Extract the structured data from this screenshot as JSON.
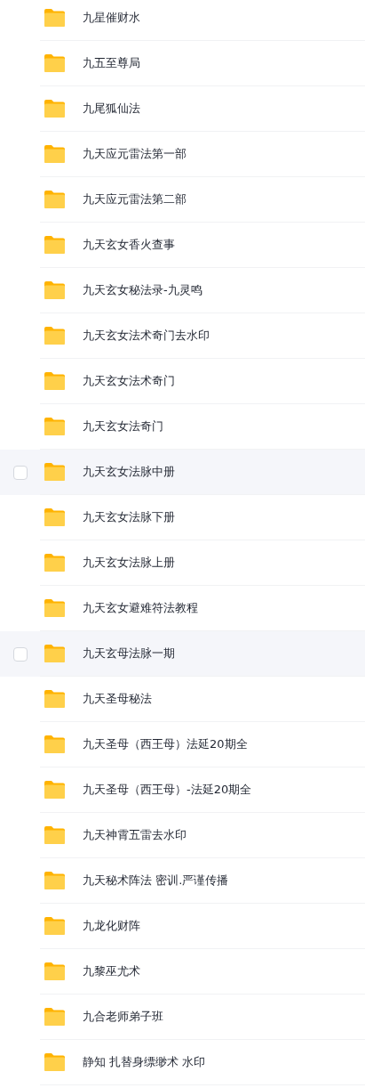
{
  "folders": [
    {
      "name": "九星催财水",
      "hovered": false
    },
    {
      "name": "九五至尊局",
      "hovered": false
    },
    {
      "name": "九尾狐仙法",
      "hovered": false
    },
    {
      "name": "九天应元雷法第一部",
      "hovered": false
    },
    {
      "name": "九天应元雷法第二部",
      "hovered": false
    },
    {
      "name": "九天玄女香火查事",
      "hovered": false
    },
    {
      "name": "九天玄女秘法录-九灵鸣",
      "hovered": false
    },
    {
      "name": "九天玄女法术奇门去水印",
      "hovered": false
    },
    {
      "name": "九天玄女法术奇门",
      "hovered": false
    },
    {
      "name": "九天玄女法奇门",
      "hovered": false
    },
    {
      "name": "九天玄女法脉中册",
      "hovered": true
    },
    {
      "name": "九天玄女法脉下册",
      "hovered": false
    },
    {
      "name": "九天玄女法脉上册",
      "hovered": false
    },
    {
      "name": "九天玄女避难符法教程",
      "hovered": false
    },
    {
      "name": "九天玄母法脉一期",
      "hovered": true
    },
    {
      "name": "九天圣母秘法",
      "hovered": false
    },
    {
      "name": "九天圣母（西王母）法延20期全",
      "hovered": false
    },
    {
      "name": "九天圣母（西王母）-法延20期全",
      "hovered": false
    },
    {
      "name": "九天神霄五雷去水印",
      "hovered": false
    },
    {
      "name": "九天秘术阵法 密训.严谨传播",
      "hovered": false
    },
    {
      "name": "九龙化财阵",
      "hovered": false
    },
    {
      "name": "九黎巫尤术",
      "hovered": false
    },
    {
      "name": "九合老师弟子班",
      "hovered": false
    },
    {
      "name": "静知 扎替身缥缈术 水印",
      "hovered": false
    }
  ]
}
